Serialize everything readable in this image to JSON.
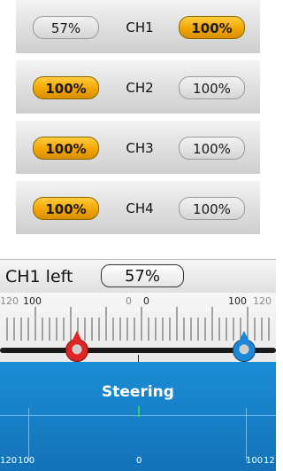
{
  "channels": [
    {
      "left_value": "57%",
      "label": "CH1",
      "right_value": "100%",
      "left_style": "grey",
      "right_style": "gold"
    },
    {
      "left_value": "100%",
      "label": "CH2",
      "right_value": "100%",
      "left_style": "gold",
      "right_style": "grey"
    },
    {
      "left_value": "100%",
      "label": "CH3",
      "right_value": "100%",
      "left_style": "gold",
      "right_style": "grey"
    },
    {
      "left_value": "100%",
      "label": "CH4",
      "right_value": "100%",
      "left_style": "gold",
      "right_style": "grey"
    }
  ],
  "trim": {
    "title": "CH1 left",
    "value": "57%",
    "scale_labels": {
      "far_left": "120",
      "left": "100",
      "center_a": "0",
      "center_b": "0",
      "right": "100",
      "far_right": "120"
    },
    "knob_left_color": "#e02525",
    "knob_right_color": "#1e88d8"
  },
  "steering": {
    "label": "Steering",
    "bottom_labels": {
      "left_a": "120",
      "left_b": "100",
      "center": "0",
      "right_a": "100",
      "right_b": "12"
    },
    "panel_color": "#1a8ed6"
  },
  "colors": {
    "gold": "#f2a500",
    "grey": "#d6d6d6"
  }
}
